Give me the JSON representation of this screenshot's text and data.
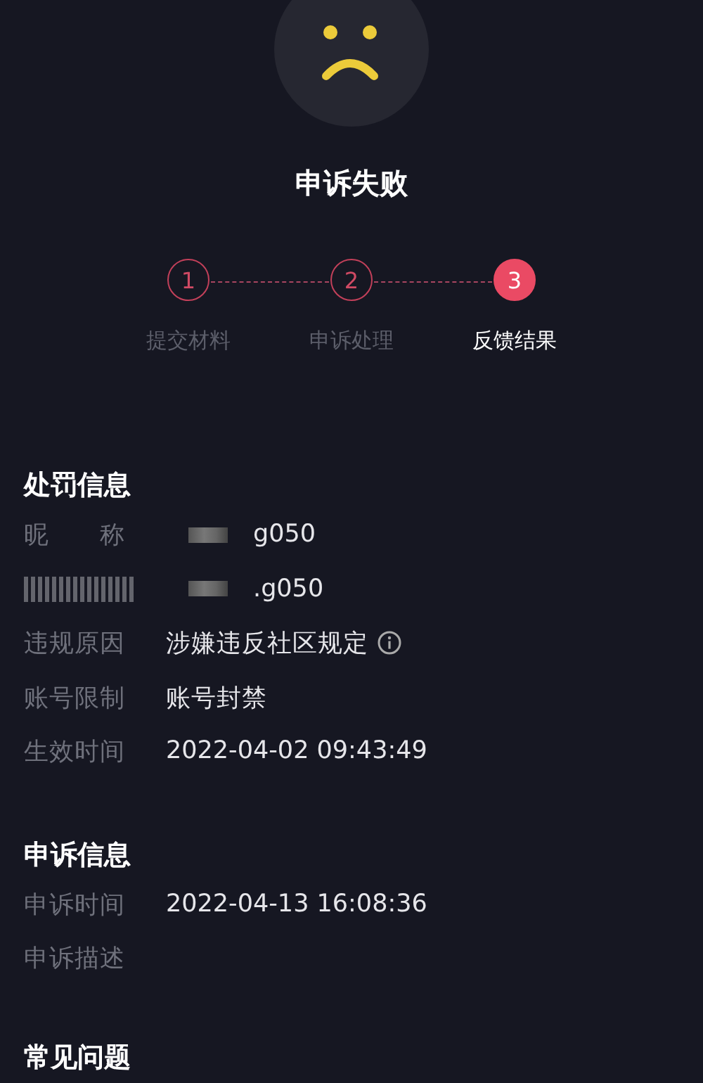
{
  "result": {
    "title": "申诉失败"
  },
  "steps": [
    {
      "number": "1",
      "label": "提交材料",
      "selected": false
    },
    {
      "number": "2",
      "label": "申诉处理",
      "selected": false
    },
    {
      "number": "3",
      "label": "反馈结果",
      "selected": true
    }
  ],
  "sections": [
    {
      "title": "处罚信息",
      "rows": [
        {
          "label": "昵　　称",
          "value": "g050",
          "redacted": true
        },
        {
          "value": ".g050",
          "redacted": true,
          "label_obscured": true
        },
        {
          "label": "违规原因",
          "value": "涉嫌违反社区规定",
          "info": true
        },
        {
          "label": "账号限制",
          "value": "账号封禁"
        },
        {
          "label": "生效时间",
          "value": "2022-04-02 09:43:49"
        }
      ]
    },
    {
      "title": "申诉信息",
      "rows": [
        {
          "label": "申诉时间",
          "value": "2022-04-13 16:08:36"
        },
        {
          "label": "申诉描述"
        }
      ]
    },
    {
      "title": "常见问题"
    }
  ]
}
